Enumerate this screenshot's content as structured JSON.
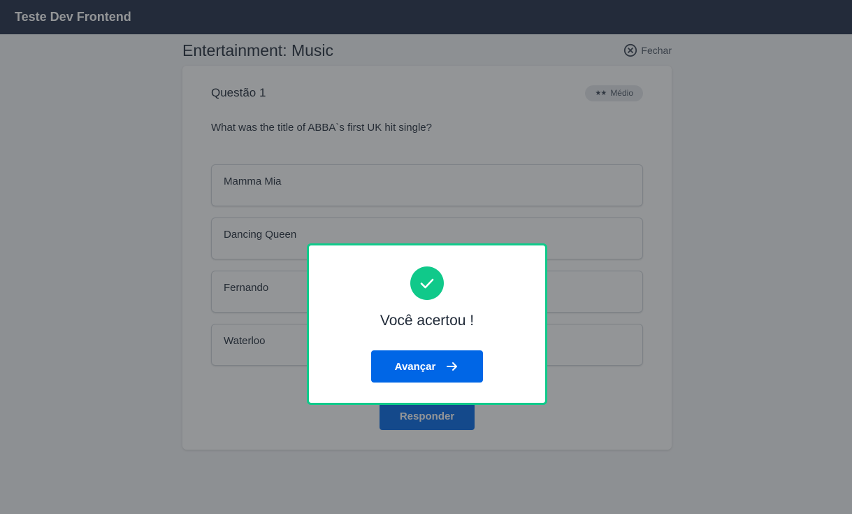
{
  "app": {
    "title": "Teste Dev Frontend"
  },
  "header": {
    "category": "Entertainment: Music",
    "close_label": "Fechar"
  },
  "question": {
    "number_label": "Questão 1",
    "difficulty": "Médio",
    "difficulty_stars": "★★",
    "text": "What was the title of ABBA`s first UK hit single?",
    "options": [
      "Mamma Mia",
      "Dancing Queen",
      "Fernando",
      "Waterloo"
    ],
    "submit_label": "Responder"
  },
  "modal": {
    "title": "Você acertou !",
    "next_label": "Avançar",
    "icon": "check-circle-icon",
    "accent": "#10c98a"
  },
  "colors": {
    "primary": "#0066e6",
    "topbar": "#1f2a44",
    "success": "#10c98a"
  }
}
